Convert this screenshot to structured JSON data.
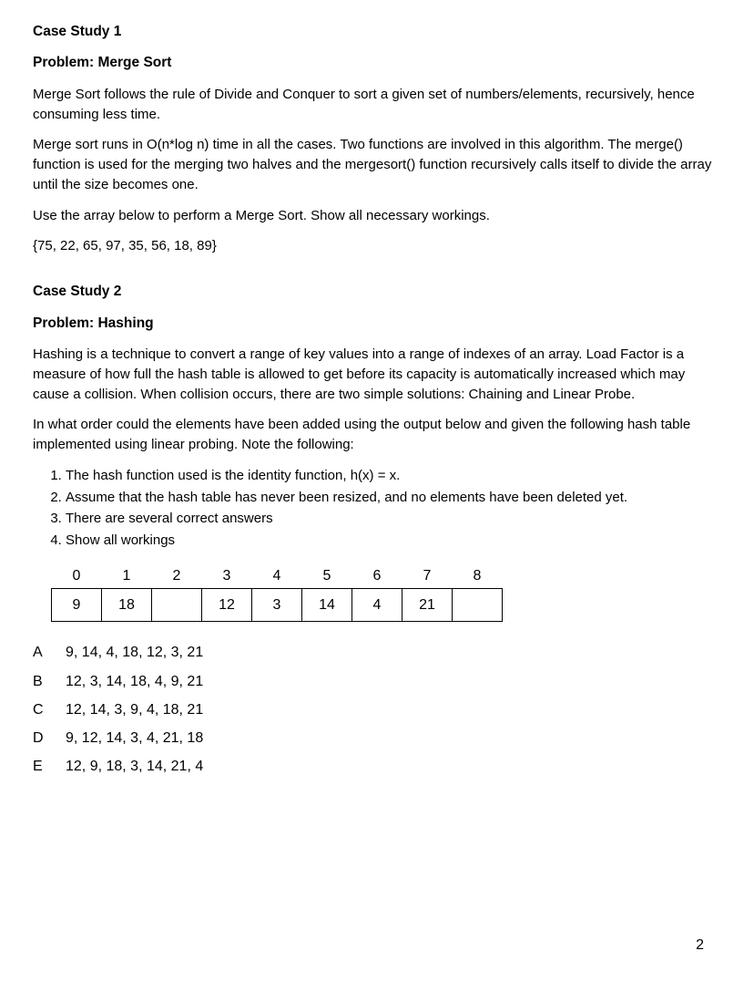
{
  "case1": {
    "title": "Case Study 1",
    "problem": "Problem: Merge Sort",
    "p1": "Merge Sort follows the rule of Divide and Conquer to sort a given set of numbers/elements, recursively, hence consuming less time.",
    "p2": "Merge sort runs in O(n*log n) time in all the cases. Two functions are involved in this algorithm. The merge()  function is used for the merging two halves and the mergesort() function recursively calls itself to divide the array until the size becomes one.",
    "p3": "Use the array below to perform a Merge Sort. Show all necessary workings.",
    "array": "{75, 22, 65, 97, 35, 56, 18, 89}"
  },
  "case2": {
    "title": "Case Study 2",
    "problem": "Problem: Hashing",
    "p1": "Hashing is a technique to convert a range of key values into a range of indexes of an array. Load Factor is a measure of how full the hash table is allowed to get before its capacity is automatically increased which may cause a collision. When collision occurs, there are two simple solutions: Chaining and Linear Probe.",
    "p2": "In what order could the elements have been added using the output below and given the following hash table implemented using linear probing. Note the following:",
    "notes": {
      "n1": "The hash function used is the identity function, h(x) = x.",
      "n2": "Assume that the hash table has never been resized, and no elements have been deleted yet.",
      "n3": "There are several correct answers",
      "n4": " Show all workings"
    },
    "table": {
      "idx": {
        "c0": "0",
        "c1": "1",
        "c2": "2",
        "c3": "3",
        "c4": "4",
        "c5": "5",
        "c6": "6",
        "c7": "7",
        "c8": "8"
      },
      "val": {
        "c0": "9",
        "c1": "18",
        "c2": "",
        "c3": "12",
        "c4": "3",
        "c5": "14",
        "c6": "4",
        "c7": "21",
        "c8": ""
      }
    },
    "options": {
      "A": {
        "label": "A",
        "value": "9, 14, 4, 18, 12, 3, 21"
      },
      "B": {
        "label": "B",
        "value": "12, 3, 14, 18, 4, 9, 21"
      },
      "C": {
        "label": "C",
        "value": "12, 14, 3, 9, 4, 18, 21"
      },
      "D": {
        "label": "D",
        "value": "9, 12, 14, 3, 4, 21, 18"
      },
      "E": {
        "label": "E",
        "value": "12, 9, 18, 3, 14, 21, 4"
      }
    }
  },
  "page_number": "2"
}
